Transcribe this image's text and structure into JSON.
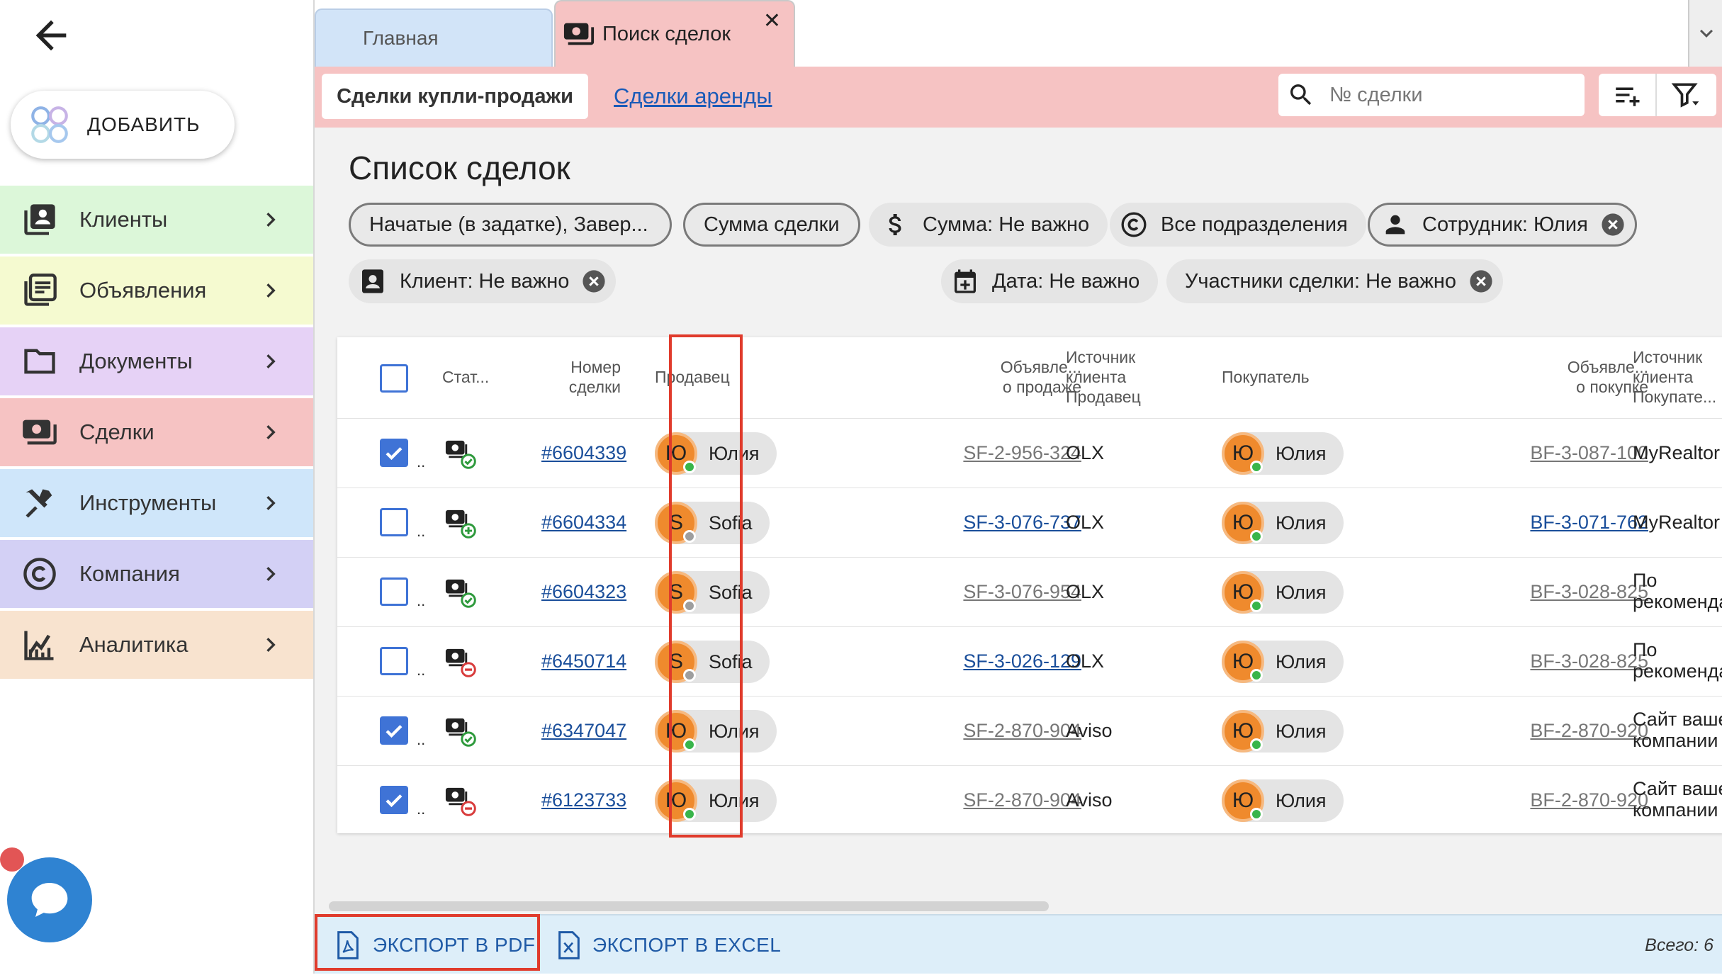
{
  "sidebar": {
    "add_label": "ДОБАВИТЬ",
    "items": [
      {
        "label": "Клиенты",
        "color": "#dcf7d9"
      },
      {
        "label": "Объявления",
        "color": "#f5fad0"
      },
      {
        "label": "Документы",
        "color": "#e6d2f6"
      },
      {
        "label": "Сделки",
        "color": "#f6c3c3"
      },
      {
        "label": "Инструменты",
        "color": "#cfe6fa"
      },
      {
        "label": "Компания",
        "color": "#d3d0f5"
      },
      {
        "label": "Аналитика",
        "color": "#f8e3cf"
      }
    ]
  },
  "tabs": {
    "home": "Главная",
    "search": "Поиск сделок",
    "close": "✕"
  },
  "toolbar": {
    "sale_tab": "Сделки купли-продажи",
    "rent_tab": "Сделки аренды",
    "search_placeholder": "№ сделки"
  },
  "page_title": "Список сделок",
  "filters": {
    "status": "Начатые (в задатке), Завер...",
    "sum_type": "Сумма сделки",
    "sum": "Сумма: Не важно",
    "divisions": "Все подразделения",
    "employee": "Сотрудник: Юлия",
    "client": "Клиент: Не важно",
    "date": "Дата: Не важно",
    "participants": "Участники сделки: Не важно"
  },
  "table": {
    "headers": {
      "status": "Стат...",
      "number_1": "Номер",
      "number_2": "сделки",
      "seller": "Продавец",
      "sale_ad_1": "Объявле...",
      "sale_ad_2": "о продаже",
      "seller_src_1": "Источник",
      "seller_src_2": "клиента",
      "seller_src_3": "Продавец",
      "buyer": "Покупатель",
      "buy_ad_1": "Объявле...",
      "buy_ad_2": "о покупке",
      "buyer_src_1": "Источник",
      "buyer_src_2": "клиента",
      "buyer_src_3": "Покупате..."
    },
    "rows": [
      {
        "checked": true,
        "status": "done",
        "number": "#6604339",
        "seller_initial": "Ю",
        "seller": "Юлия",
        "seller_online": true,
        "sale_ad": "SF-2-956-324",
        "sale_ad_active": false,
        "seller_source": "OLX",
        "buyer_initial": "Ю",
        "buyer": "Юлия",
        "buy_ad": "BF-3-087-100",
        "buy_ad_active": false,
        "buyer_source_1": "MyRealtor",
        "buyer_source_2": ""
      },
      {
        "checked": false,
        "status": "new",
        "number": "#6604334",
        "seller_initial": "S",
        "seller": "Sofia",
        "seller_online": false,
        "sale_ad": "SF-3-076-737",
        "sale_ad_active": true,
        "seller_source": "OLX",
        "buyer_initial": "Ю",
        "buyer": "Юлия",
        "buy_ad": "BF-3-071-762",
        "buy_ad_active": true,
        "buyer_source_1": "MyRealtor",
        "buyer_source_2": ""
      },
      {
        "checked": false,
        "status": "done",
        "number": "#6604323",
        "seller_initial": "S",
        "seller": "Sofia",
        "seller_online": false,
        "sale_ad": "SF-3-076-954",
        "sale_ad_active": false,
        "seller_source": "OLX",
        "buyer_initial": "Ю",
        "buyer": "Юлия",
        "buy_ad": "BF-3-028-825",
        "buy_ad_active": false,
        "buyer_source_1": "По",
        "buyer_source_2": "рекоменда"
      },
      {
        "checked": false,
        "status": "cancel",
        "number": "#6450714",
        "seller_initial": "S",
        "seller": "Sofia",
        "seller_online": false,
        "sale_ad": "SF-3-026-129",
        "sale_ad_active": true,
        "seller_source": "OLX",
        "buyer_initial": "Ю",
        "buyer": "Юлия",
        "buy_ad": "BF-3-028-825",
        "buy_ad_active": false,
        "buyer_source_1": "По",
        "buyer_source_2": "рекоменда"
      },
      {
        "checked": true,
        "status": "done",
        "number": "#6347047",
        "seller_initial": "Ю",
        "seller": "Юлия",
        "seller_online": true,
        "sale_ad": "SF-2-870-904",
        "sale_ad_active": false,
        "seller_source": "Aviso",
        "buyer_initial": "Ю",
        "buyer": "Юлия",
        "buy_ad": "BF-2-870-920",
        "buy_ad_active": false,
        "buyer_source_1": "Сайт ваше",
        "buyer_source_2": "компании"
      },
      {
        "checked": true,
        "status": "cancel",
        "number": "#6123733",
        "seller_initial": "Ю",
        "seller": "Юлия",
        "seller_online": true,
        "sale_ad": "SF-2-870-904",
        "sale_ad_active": false,
        "seller_source": "Aviso",
        "buyer_initial": "Ю",
        "buyer": "Юлия",
        "buy_ad": "BF-2-870-920",
        "buy_ad_active": false,
        "buyer_source_1": "Сайт ваше",
        "buyer_source_2": "компании"
      }
    ]
  },
  "footer": {
    "export_pdf": "ЭКСПОРТ В PDF",
    "export_excel": "ЭКСПОРТ В EXCEL",
    "total": "Всего: 6"
  },
  "colors": {
    "accent": "#3f73d6",
    "highlight": "#e03b2c",
    "avatar": "#ef8a2d",
    "online": "#39b54a",
    "offline": "#9e9e9e"
  }
}
